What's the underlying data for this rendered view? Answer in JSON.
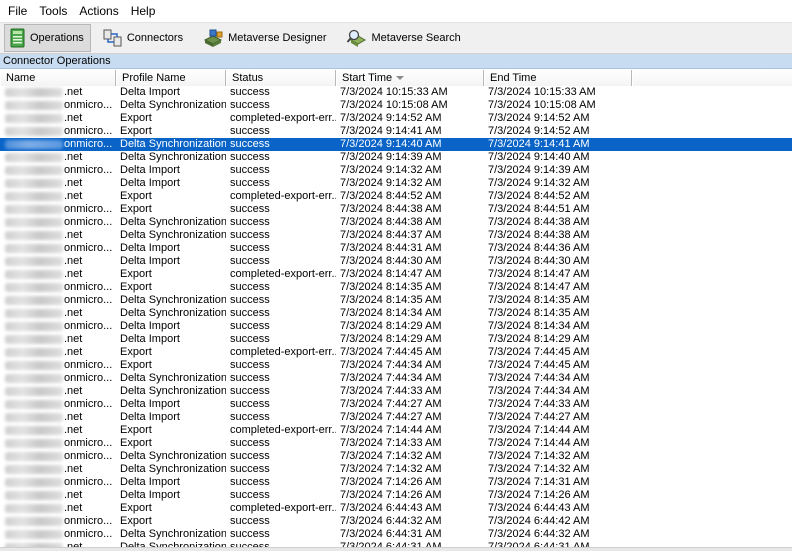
{
  "menu": [
    {
      "label": "File"
    },
    {
      "label": "Tools"
    },
    {
      "label": "Actions"
    },
    {
      "label": "Help"
    }
  ],
  "toolbar": [
    {
      "label": "Operations",
      "icon": "operations-icon",
      "active": true
    },
    {
      "label": "Connectors",
      "icon": "connectors-icon",
      "active": false
    },
    {
      "label": "Metaverse Designer",
      "icon": "metaverse-designer-icon",
      "active": false
    },
    {
      "label": "Metaverse Search",
      "icon": "metaverse-search-icon",
      "active": false
    }
  ],
  "panel": {
    "title": "Connector Operations"
  },
  "columns": [
    "Name",
    "Profile Name",
    "Status",
    "Start Time",
    "End Time"
  ],
  "sort": {
    "column": "Start Time",
    "direction": "descending"
  },
  "selection_color": "#0a64c8",
  "rows": [
    {
      "name": ".net",
      "profile": "Delta Import",
      "status": "success",
      "start": "7/3/2024 10:15:33 AM",
      "end": "7/3/2024 10:15:33 AM"
    },
    {
      "name": "onmicro...",
      "profile": "Delta Synchronization",
      "status": "success",
      "start": "7/3/2024 10:15:08 AM",
      "end": "7/3/2024 10:15:08 AM"
    },
    {
      "name": ".net",
      "profile": "Export",
      "status": "completed-export-err...",
      "start": "7/3/2024 9:14:52 AM",
      "end": "7/3/2024 9:14:52 AM"
    },
    {
      "name": "onmicro...",
      "profile": "Export",
      "status": "success",
      "start": "7/3/2024 9:14:41 AM",
      "end": "7/3/2024 9:14:52 AM"
    },
    {
      "name": "onmicro...",
      "profile": "Delta Synchronization",
      "status": "success",
      "start": "7/3/2024 9:14:40 AM",
      "end": "7/3/2024 9:14:41 AM",
      "selected": true
    },
    {
      "name": ".net",
      "profile": "Delta Synchronization",
      "status": "success",
      "start": "7/3/2024 9:14:39 AM",
      "end": "7/3/2024 9:14:40 AM"
    },
    {
      "name": "onmicro...",
      "profile": "Delta Import",
      "status": "success",
      "start": "7/3/2024 9:14:32 AM",
      "end": "7/3/2024 9:14:39 AM"
    },
    {
      "name": ".net",
      "profile": "Delta Import",
      "status": "success",
      "start": "7/3/2024 9:14:32 AM",
      "end": "7/3/2024 9:14:32 AM"
    },
    {
      "name": ".net",
      "profile": "Export",
      "status": "completed-export-err...",
      "start": "7/3/2024 8:44:52 AM",
      "end": "7/3/2024 8:44:52 AM"
    },
    {
      "name": "onmicro...",
      "profile": "Export",
      "status": "success",
      "start": "7/3/2024 8:44:38 AM",
      "end": "7/3/2024 8:44:51 AM"
    },
    {
      "name": "onmicro...",
      "profile": "Delta Synchronization",
      "status": "success",
      "start": "7/3/2024 8:44:38 AM",
      "end": "7/3/2024 8:44:38 AM"
    },
    {
      "name": ".net",
      "profile": "Delta Synchronization",
      "status": "success",
      "start": "7/3/2024 8:44:37 AM",
      "end": "7/3/2024 8:44:38 AM"
    },
    {
      "name": "onmicro...",
      "profile": "Delta Import",
      "status": "success",
      "start": "7/3/2024 8:44:31 AM",
      "end": "7/3/2024 8:44:36 AM"
    },
    {
      "name": ".net",
      "profile": "Delta Import",
      "status": "success",
      "start": "7/3/2024 8:44:30 AM",
      "end": "7/3/2024 8:44:30 AM"
    },
    {
      "name": ".net",
      "profile": "Export",
      "status": "completed-export-err...",
      "start": "7/3/2024 8:14:47 AM",
      "end": "7/3/2024 8:14:47 AM"
    },
    {
      "name": "onmicro...",
      "profile": "Export",
      "status": "success",
      "start": "7/3/2024 8:14:35 AM",
      "end": "7/3/2024 8:14:47 AM"
    },
    {
      "name": "onmicro...",
      "profile": "Delta Synchronization",
      "status": "success",
      "start": "7/3/2024 8:14:35 AM",
      "end": "7/3/2024 8:14:35 AM"
    },
    {
      "name": ".net",
      "profile": "Delta Synchronization",
      "status": "success",
      "start": "7/3/2024 8:14:34 AM",
      "end": "7/3/2024 8:14:35 AM"
    },
    {
      "name": "onmicro...",
      "profile": "Delta Import",
      "status": "success",
      "start": "7/3/2024 8:14:29 AM",
      "end": "7/3/2024 8:14:34 AM"
    },
    {
      "name": ".net",
      "profile": "Delta Import",
      "status": "success",
      "start": "7/3/2024 8:14:29 AM",
      "end": "7/3/2024 8:14:29 AM"
    },
    {
      "name": ".net",
      "profile": "Export",
      "status": "completed-export-err...",
      "start": "7/3/2024 7:44:45 AM",
      "end": "7/3/2024 7:44:45 AM"
    },
    {
      "name": "onmicro...",
      "profile": "Export",
      "status": "success",
      "start": "7/3/2024 7:44:34 AM",
      "end": "7/3/2024 7:44:45 AM"
    },
    {
      "name": "onmicro...",
      "profile": "Delta Synchronization",
      "status": "success",
      "start": "7/3/2024 7:44:34 AM",
      "end": "7/3/2024 7:44:34 AM"
    },
    {
      "name": ".net",
      "profile": "Delta Synchronization",
      "status": "success",
      "start": "7/3/2024 7:44:33 AM",
      "end": "7/3/2024 7:44:34 AM"
    },
    {
      "name": "onmicro...",
      "profile": "Delta Import",
      "status": "success",
      "start": "7/3/2024 7:44:27 AM",
      "end": "7/3/2024 7:44:33 AM"
    },
    {
      "name": ".net",
      "profile": "Delta Import",
      "status": "success",
      "start": "7/3/2024 7:44:27 AM",
      "end": "7/3/2024 7:44:27 AM"
    },
    {
      "name": ".net",
      "profile": "Export",
      "status": "completed-export-err...",
      "start": "7/3/2024 7:14:44 AM",
      "end": "7/3/2024 7:14:44 AM"
    },
    {
      "name": "onmicro...",
      "profile": "Export",
      "status": "success",
      "start": "7/3/2024 7:14:33 AM",
      "end": "7/3/2024 7:14:44 AM"
    },
    {
      "name": "onmicro...",
      "profile": "Delta Synchronization",
      "status": "success",
      "start": "7/3/2024 7:14:32 AM",
      "end": "7/3/2024 7:14:32 AM"
    },
    {
      "name": ".net",
      "profile": "Delta Synchronization",
      "status": "success",
      "start": "7/3/2024 7:14:32 AM",
      "end": "7/3/2024 7:14:32 AM"
    },
    {
      "name": "onmicro...",
      "profile": "Delta Import",
      "status": "success",
      "start": "7/3/2024 7:14:26 AM",
      "end": "7/3/2024 7:14:31 AM"
    },
    {
      "name": ".net",
      "profile": "Delta Import",
      "status": "success",
      "start": "7/3/2024 7:14:26 AM",
      "end": "7/3/2024 7:14:26 AM"
    },
    {
      "name": ".net",
      "profile": "Export",
      "status": "completed-export-err...",
      "start": "7/3/2024 6:44:43 AM",
      "end": "7/3/2024 6:44:43 AM"
    },
    {
      "name": "onmicro...",
      "profile": "Export",
      "status": "success",
      "start": "7/3/2024 6:44:32 AM",
      "end": "7/3/2024 6:44:42 AM"
    },
    {
      "name": "onmicro...",
      "profile": "Delta Synchronization",
      "status": "success",
      "start": "7/3/2024 6:44:31 AM",
      "end": "7/3/2024 6:44:32 AM"
    },
    {
      "name": ".net",
      "profile": "Delta Synchronization",
      "status": "success",
      "start": "7/3/2024 6:44:31 AM",
      "end": "7/3/2024 6:44:31 AM"
    }
  ]
}
